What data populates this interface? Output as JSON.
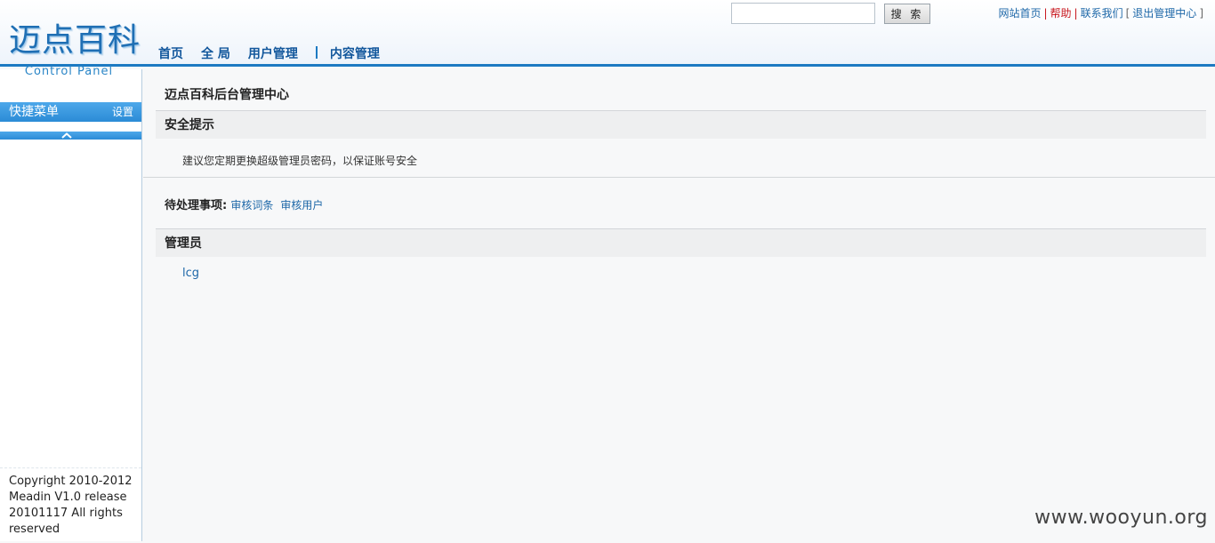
{
  "logo": {
    "title": "迈点百科",
    "subtitle": "Control Panel"
  },
  "search": {
    "value": "",
    "placeholder": "",
    "button_label": "搜 索"
  },
  "toplinks": {
    "site_home": "网站首页",
    "help": "帮助",
    "contact": "联系我们",
    "logout": "退出管理中心"
  },
  "nav": {
    "items": [
      "首页",
      "全 局",
      "用户管理",
      "内容管理"
    ]
  },
  "sidebar": {
    "quick_menu": "快捷菜单",
    "settings": "设置",
    "copyright": "Copyright 2010-2012 Meadin V1.0 release 20101117 All rights reserved"
  },
  "main": {
    "page_title": "迈点百科后台管理中心",
    "security": {
      "heading": "安全提示",
      "text": "建议您定期更换超级管理员密码，以保证账号安全"
    },
    "pending": {
      "label": "待处理事项:",
      "links": [
        "审核词条",
        "审核用户"
      ]
    },
    "admins": {
      "heading": "管理员",
      "names": [
        "lcg"
      ]
    }
  },
  "watermark": "www.wooyun.org",
  "colors": {
    "accent": "#1d7ac2",
    "link": "#1d67a8",
    "help_link": "#c8161d"
  }
}
